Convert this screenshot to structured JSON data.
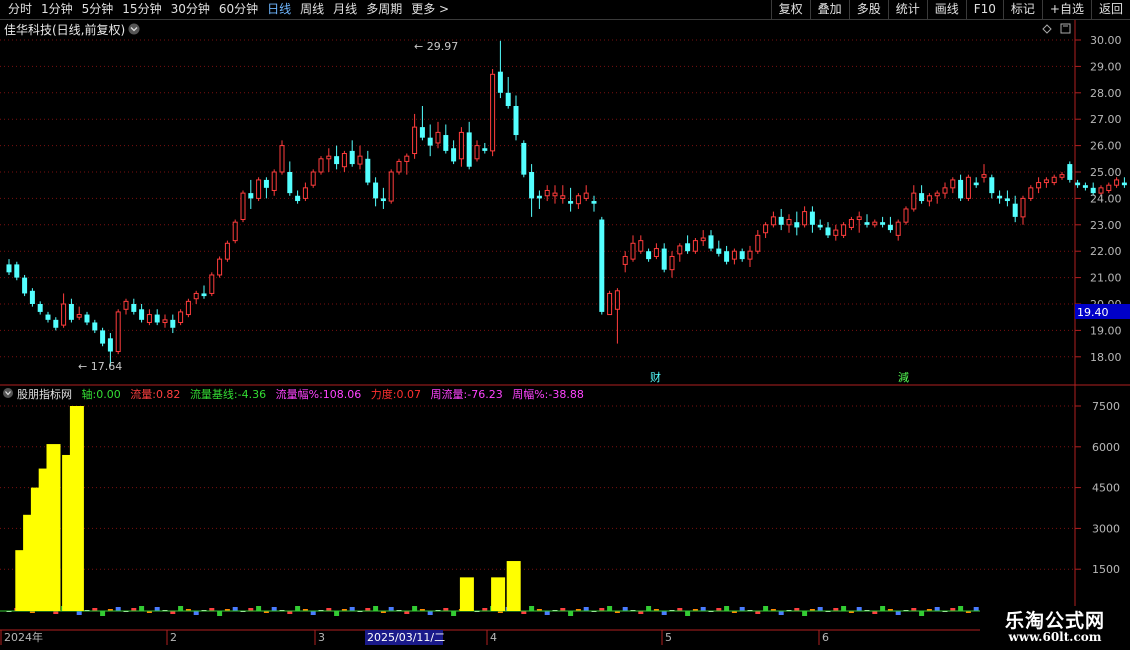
{
  "toolbar": {
    "periods": [
      "分时",
      "1分钟",
      "5分钟",
      "15分钟",
      "30分钟",
      "60分钟",
      "日线",
      "周线",
      "月线",
      "多周期",
      "更多 >"
    ],
    "active_period": "日线",
    "right_buttons": [
      "复权",
      "叠加",
      "多股",
      "统计",
      "画线",
      "F10",
      "标记",
      "+自选",
      "返回"
    ]
  },
  "main_panel": {
    "title": "佳华科技(日线,前复权)",
    "high_marker": "29.97",
    "low_marker": "17.64",
    "price_ticks": [
      "30.00",
      "29.00",
      "28.00",
      "27.00",
      "26.00",
      "25.00",
      "24.00",
      "23.00",
      "22.00",
      "21.00",
      "20.00",
      "19.00",
      "18.00"
    ],
    "current_price_box": "19.40",
    "event_marks": [
      "财",
      "減"
    ]
  },
  "indicator_panel": {
    "name": "股朋指标网",
    "fields": [
      {
        "label": "轴:",
        "value": "0.00",
        "color": "#33dd33"
      },
      {
        "label": "流量:",
        "value": "0.82",
        "color": "#ff4040"
      },
      {
        "label": "流量基线:",
        "value": "-4.36",
        "color": "#33dd33"
      },
      {
        "label": "流量幅%:",
        "value": "108.06",
        "color": "#ff44ff"
      },
      {
        "label": "力度:",
        "value": "0.07",
        "color": "#ff3030"
      },
      {
        "label": "周流量:",
        "value": "-76.23",
        "color": "#ff44ff"
      },
      {
        "label": "周幅%:",
        "value": "-38.88",
        "color": "#ff44ff"
      }
    ],
    "ticks": [
      "7500",
      "6000",
      "4500",
      "3000",
      "1500"
    ]
  },
  "date_axis": {
    "labels": [
      "2024年",
      "2",
      "3",
      "4",
      "5",
      "6"
    ],
    "cursor_date": "2025/03/11/二"
  },
  "watermark": {
    "title": "乐淘公式网",
    "url": "www.60lt.com"
  },
  "colors": {
    "up": "#ff3c3c",
    "down": "#54ffff",
    "grid": "#7a1010",
    "axis": "#b02020",
    "bar": "#ffff00"
  },
  "chart_data": {
    "type": "candlestick",
    "ylim": [
      17.4,
      30.4
    ],
    "candles": [
      [
        21.5,
        21.7,
        21.1,
        21.2
      ],
      [
        21.5,
        21.6,
        20.9,
        21.0
      ],
      [
        21.0,
        21.1,
        20.3,
        20.4
      ],
      [
        20.5,
        20.6,
        19.9,
        20.0
      ],
      [
        20.0,
        20.1,
        19.6,
        19.7
      ],
      [
        19.6,
        19.7,
        19.3,
        19.4
      ],
      [
        19.4,
        19.5,
        19.0,
        19.1
      ],
      [
        19.2,
        20.4,
        19.1,
        20.0
      ],
      [
        20.0,
        20.2,
        19.3,
        19.4
      ],
      [
        19.5,
        19.9,
        19.4,
        19.6
      ],
      [
        19.6,
        19.7,
        19.2,
        19.3
      ],
      [
        19.3,
        19.4,
        18.9,
        19.0
      ],
      [
        19.0,
        19.1,
        18.4,
        18.5
      ],
      [
        18.7,
        18.9,
        17.64,
        18.2
      ],
      [
        18.2,
        19.8,
        18.1,
        19.7
      ],
      [
        19.8,
        20.2,
        19.6,
        20.1
      ],
      [
        20.0,
        20.2,
        19.6,
        19.7
      ],
      [
        19.8,
        20.0,
        19.3,
        19.4
      ],
      [
        19.3,
        19.8,
        19.2,
        19.6
      ],
      [
        19.6,
        19.8,
        19.2,
        19.3
      ],
      [
        19.3,
        19.6,
        19.1,
        19.4
      ],
      [
        19.4,
        19.6,
        18.9,
        19.1
      ],
      [
        19.3,
        19.8,
        19.2,
        19.7
      ],
      [
        19.6,
        20.2,
        19.5,
        20.1
      ],
      [
        20.2,
        20.5,
        20.0,
        20.4
      ],
      [
        20.4,
        20.7,
        20.2,
        20.3
      ],
      [
        20.4,
        21.2,
        20.3,
        21.1
      ],
      [
        21.1,
        21.8,
        21.0,
        21.7
      ],
      [
        21.7,
        22.4,
        21.6,
        22.3
      ],
      [
        22.4,
        23.2,
        22.3,
        23.1
      ],
      [
        23.2,
        24.3,
        23.1,
        24.2
      ],
      [
        24.2,
        24.7,
        23.6,
        24.0
      ],
      [
        24.0,
        24.8,
        23.9,
        24.7
      ],
      [
        24.7,
        24.8,
        24.0,
        24.4
      ],
      [
        24.3,
        25.1,
        24.1,
        25.0
      ],
      [
        25.0,
        26.2,
        24.9,
        26.0
      ],
      [
        25.0,
        25.4,
        24.1,
        24.2
      ],
      [
        24.1,
        24.3,
        23.8,
        23.9
      ],
      [
        24.0,
        24.6,
        23.9,
        24.4
      ],
      [
        24.5,
        25.1,
        24.4,
        25.0
      ],
      [
        25.0,
        25.6,
        24.9,
        25.5
      ],
      [
        25.5,
        25.9,
        25.0,
        25.6
      ],
      [
        25.6,
        26.0,
        25.1,
        25.3
      ],
      [
        25.2,
        25.8,
        25.0,
        25.7
      ],
      [
        25.8,
        26.2,
        25.2,
        25.3
      ],
      [
        25.3,
        26.0,
        25.1,
        25.6
      ],
      [
        25.5,
        25.8,
        24.5,
        24.6
      ],
      [
        24.6,
        24.8,
        23.7,
        24.0
      ],
      [
        24.0,
        24.4,
        23.6,
        23.9
      ],
      [
        23.9,
        25.1,
        23.8,
        25.0
      ],
      [
        25.0,
        25.5,
        24.9,
        25.4
      ],
      [
        25.4,
        25.7,
        24.9,
        25.6
      ],
      [
        25.7,
        27.2,
        25.5,
        26.7
      ],
      [
        26.7,
        27.5,
        26.2,
        26.3
      ],
      [
        26.3,
        26.8,
        25.6,
        26.0
      ],
      [
        26.1,
        26.9,
        25.9,
        26.5
      ],
      [
        26.4,
        26.8,
        25.7,
        25.8
      ],
      [
        25.9,
        26.2,
        25.3,
        25.4
      ],
      [
        25.5,
        26.7,
        25.2,
        26.5
      ],
      [
        26.5,
        26.9,
        25.1,
        25.2
      ],
      [
        25.5,
        26.2,
        25.4,
        26.0
      ],
      [
        25.9,
        26.1,
        25.7,
        25.8
      ],
      [
        25.8,
        28.9,
        25.6,
        28.7
      ],
      [
        28.8,
        29.97,
        27.8,
        28.0
      ],
      [
        28.0,
        28.6,
        27.4,
        27.5
      ],
      [
        27.5,
        27.9,
        26.2,
        26.4
      ],
      [
        26.1,
        26.2,
        24.8,
        24.9
      ],
      [
        25.0,
        25.3,
        23.3,
        24.0
      ],
      [
        24.1,
        24.3,
        23.6,
        24.0
      ],
      [
        24.1,
        24.5,
        23.9,
        24.3
      ],
      [
        24.1,
        24.5,
        23.8,
        24.2
      ],
      [
        24.0,
        24.5,
        23.8,
        24.1
      ],
      [
        23.9,
        24.4,
        23.5,
        23.8
      ],
      [
        23.8,
        24.2,
        23.6,
        24.1
      ],
      [
        24.0,
        24.5,
        23.9,
        24.2
      ],
      [
        23.9,
        24.1,
        23.5,
        23.8
      ],
      [
        23.2,
        23.3,
        19.6,
        19.7
      ],
      [
        19.6,
        20.5,
        19.6,
        20.4
      ],
      [
        19.8,
        20.6,
        18.5,
        20.5
      ],
      [
        21.5,
        22.0,
        21.2,
        21.8
      ],
      [
        21.7,
        22.6,
        21.6,
        22.3
      ],
      [
        22.0,
        22.6,
        21.9,
        22.4
      ],
      [
        22.0,
        22.1,
        21.6,
        21.7
      ],
      [
        21.8,
        22.3,
        21.7,
        22.1
      ],
      [
        22.1,
        22.3,
        21.2,
        21.3
      ],
      [
        21.3,
        22.0,
        21.0,
        21.8
      ],
      [
        21.9,
        22.3,
        21.6,
        22.2
      ],
      [
        22.3,
        22.6,
        21.9,
        22.0
      ],
      [
        22.0,
        22.5,
        21.9,
        22.4
      ],
      [
        22.4,
        22.8,
        22.2,
        22.5
      ],
      [
        22.6,
        22.8,
        22.0,
        22.1
      ],
      [
        22.1,
        22.4,
        21.8,
        21.9
      ],
      [
        22.0,
        22.2,
        21.5,
        21.6
      ],
      [
        21.7,
        22.1,
        21.5,
        22.0
      ],
      [
        22.0,
        22.1,
        21.6,
        21.7
      ],
      [
        21.7,
        22.2,
        21.4,
        22.0
      ],
      [
        22.0,
        22.8,
        21.9,
        22.6
      ],
      [
        22.7,
        23.1,
        22.5,
        23.0
      ],
      [
        23.0,
        23.5,
        22.9,
        23.3
      ],
      [
        23.3,
        23.6,
        22.8,
        23.0
      ],
      [
        23.0,
        23.4,
        22.7,
        23.2
      ],
      [
        23.1,
        23.5,
        22.6,
        22.9
      ],
      [
        23.0,
        23.7,
        22.9,
        23.5
      ],
      [
        23.5,
        23.7,
        22.7,
        23.0
      ],
      [
        23.0,
        23.2,
        22.8,
        22.9
      ],
      [
        22.9,
        23.1,
        22.5,
        22.6
      ],
      [
        22.6,
        23.0,
        22.4,
        22.8
      ],
      [
        22.6,
        23.1,
        22.5,
        23.0
      ],
      [
        22.9,
        23.3,
        22.8,
        23.2
      ],
      [
        23.2,
        23.5,
        22.7,
        23.3
      ],
      [
        23.1,
        23.4,
        22.9,
        23.0
      ],
      [
        23.0,
        23.2,
        22.9,
        23.1
      ],
      [
        23.1,
        23.3,
        22.9,
        23.0
      ],
      [
        23.0,
        23.3,
        22.7,
        22.8
      ],
      [
        22.6,
        23.2,
        22.4,
        23.1
      ],
      [
        23.1,
        23.7,
        23.0,
        23.6
      ],
      [
        23.6,
        24.5,
        23.5,
        24.2
      ],
      [
        24.2,
        24.5,
        23.8,
        23.9
      ],
      [
        23.9,
        24.2,
        23.7,
        24.1
      ],
      [
        24.1,
        24.3,
        23.8,
        24.2
      ],
      [
        24.2,
        24.6,
        24.0,
        24.4
      ],
      [
        24.4,
        24.8,
        24.2,
        24.7
      ],
      [
        24.7,
        24.9,
        23.9,
        24.0
      ],
      [
        24.0,
        24.9,
        23.9,
        24.8
      ],
      [
        24.6,
        24.8,
        24.4,
        24.5
      ],
      [
        24.8,
        25.3,
        24.6,
        24.9
      ],
      [
        24.8,
        24.9,
        24.0,
        24.2
      ],
      [
        24.1,
        24.3,
        23.8,
        24.0
      ],
      [
        24.0,
        24.3,
        23.7,
        23.9
      ],
      [
        23.8,
        24.1,
        23.1,
        23.3
      ],
      [
        23.3,
        24.1,
        23.0,
        24.0
      ],
      [
        24.0,
        24.5,
        23.9,
        24.4
      ],
      [
        24.4,
        24.8,
        24.2,
        24.6
      ],
      [
        24.6,
        24.8,
        24.4,
        24.7
      ],
      [
        24.6,
        24.9,
        24.5,
        24.8
      ],
      [
        24.8,
        25.0,
        24.7,
        24.9
      ],
      [
        25.3,
        25.4,
        24.6,
        24.7
      ],
      [
        24.6,
        24.7,
        24.4,
        24.5
      ],
      [
        24.5,
        24.6,
        24.3,
        24.4
      ],
      [
        24.4,
        24.6,
        24.1,
        24.2
      ],
      [
        24.2,
        24.5,
        24.1,
        24.4
      ],
      [
        24.3,
        24.6,
        24.2,
        24.5
      ],
      [
        24.5,
        24.8,
        24.4,
        24.7
      ],
      [
        24.6,
        24.8,
        24.4,
        24.5
      ]
    ]
  },
  "flow_bars": [
    {
      "i": 1,
      "v": 2200
    },
    {
      "i": 2,
      "v": 3500
    },
    {
      "i": 3,
      "v": 4500
    },
    {
      "i": 4,
      "v": 5200
    },
    {
      "i": 5,
      "v": 6100
    },
    {
      "i": 7,
      "v": 5700
    },
    {
      "i": 8,
      "v": 7500
    },
    {
      "i": 58,
      "v": 1200
    },
    {
      "i": 62,
      "v": 1200
    },
    {
      "i": 64,
      "v": 1800
    }
  ]
}
